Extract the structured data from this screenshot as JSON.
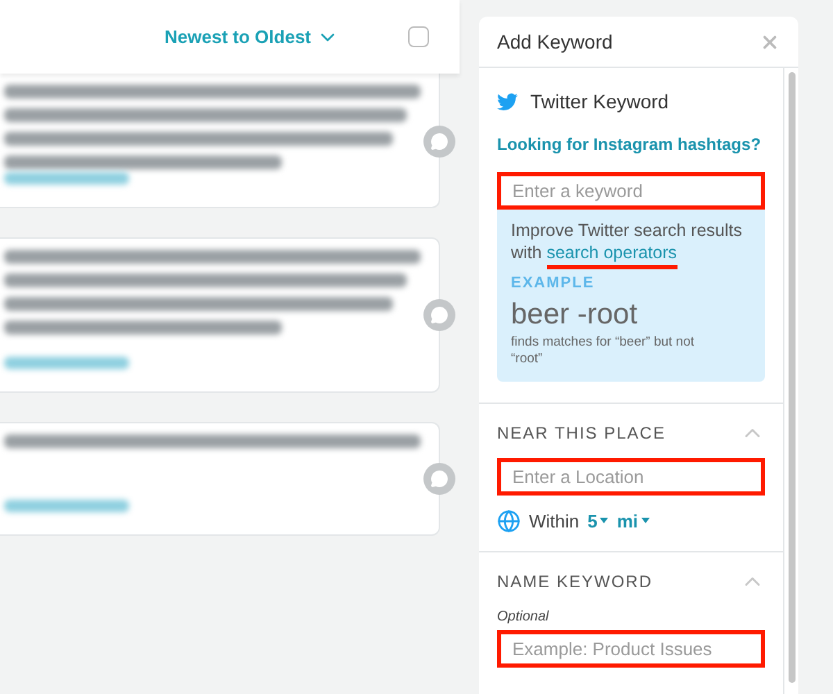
{
  "sort": {
    "label": "Newest to Oldest"
  },
  "select_all": {
    "checked": false
  },
  "posts": [
    {
      "kind": "cut"
    },
    {
      "kind": "long"
    },
    {
      "kind": "short"
    }
  ],
  "panel": {
    "title": "Add Keyword",
    "twitter": {
      "label": "Twitter Keyword",
      "link": "Looking for Instagram hashtags?",
      "placeholder": "Enter a keyword",
      "highlighted": true,
      "tip": {
        "text": "Improve Twitter search results with",
        "link": "search operators",
        "link_underlined": true,
        "example_label": "EXAMPLE",
        "example": "beer -root",
        "example_note": "finds matches for “beer” but not “root”"
      }
    },
    "near": {
      "heading": "NEAR THIS PLACE",
      "expanded": true,
      "placeholder": "Enter a Location",
      "highlighted": true,
      "within": "Within",
      "distance": "5",
      "unit": "mi"
    },
    "name": {
      "heading": "NAME KEYWORD",
      "expanded": true,
      "optional": "Optional",
      "placeholder": "Example: Product Issues",
      "highlighted": true
    }
  }
}
